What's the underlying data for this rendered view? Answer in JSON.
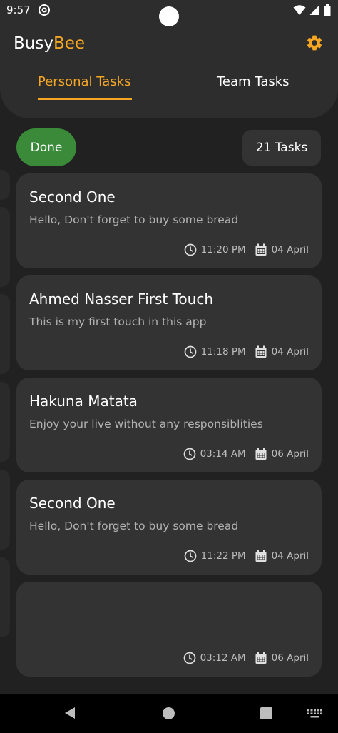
{
  "status_bar": {
    "time": "9:57",
    "icons": [
      "at-sign-icon",
      "wifi-icon",
      "cellular-signal-icon",
      "battery-icon"
    ]
  },
  "header": {
    "brand_part1": "Busy",
    "brand_part2": "Bee",
    "settings_icon": "gear-icon",
    "tabs": [
      {
        "label": "Personal Tasks",
        "selected": true
      },
      {
        "label": "Team Tasks",
        "selected": false
      }
    ]
  },
  "filter": {
    "status_label": "Done",
    "count_label": "21 Tasks"
  },
  "tasks": [
    {
      "title": "Second One",
      "description": "Hello, Don't forget to buy some bread",
      "time": "11:20 PM",
      "date": "04 April"
    },
    {
      "title": "Ahmed Nasser First Touch",
      "description": "This is my first touch in this app",
      "time": "11:18 PM",
      "date": "04 April"
    },
    {
      "title": "Hakuna Matata",
      "description": "Enjoy your live without any responsiblities",
      "time": "03:14 AM",
      "date": "06 April"
    },
    {
      "title": "Second One",
      "description": "Hello, Don't forget to buy some bread",
      "time": "11:22 PM",
      "date": "04 April"
    },
    {
      "title": "",
      "description": "",
      "time": "03:12 AM",
      "date": "06 April"
    }
  ],
  "colors": {
    "accent": "#f5a623",
    "done_green": "#3a8a3a",
    "card": "#333333",
    "background": "#212121"
  },
  "nav_bar": {
    "icons": [
      "back-icon",
      "home-icon",
      "recents-icon",
      "keyboard-icon"
    ]
  }
}
